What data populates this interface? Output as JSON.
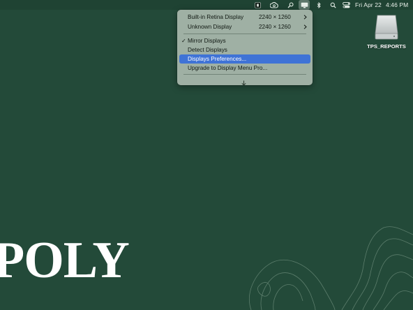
{
  "menubar": {
    "clock_date": "Fri Apr 22",
    "clock_time": "4:46 PM",
    "icons": [
      "dark-app-icon",
      "creative-cloud-icon",
      "search-tool-icon",
      "display-menu-icon",
      "bluetooth-icon",
      "spotlight-search-icon",
      "control-center-icon"
    ]
  },
  "menu": {
    "items": [
      {
        "label": "Built-in Retina Display",
        "resolution": "2240 × 1260",
        "submenu": true
      },
      {
        "label": "Unknown Display",
        "resolution": "2240 × 1260",
        "submenu": true
      },
      {
        "label": "Mirror Displays",
        "checked": true
      },
      {
        "label": "Detect Displays"
      },
      {
        "label": "Displays Preferences...",
        "highlighted": true
      },
      {
        "label": "Upgrade to Display Menu Pro..."
      }
    ]
  },
  "desktop": {
    "drive_label": "TPS_REPORTS",
    "wallpaper_text": "POLY"
  },
  "colors": {
    "background": "#234a39",
    "menubar": "#1f4333",
    "menu": "#9fb0a4",
    "highlight": "#3f73d6"
  }
}
